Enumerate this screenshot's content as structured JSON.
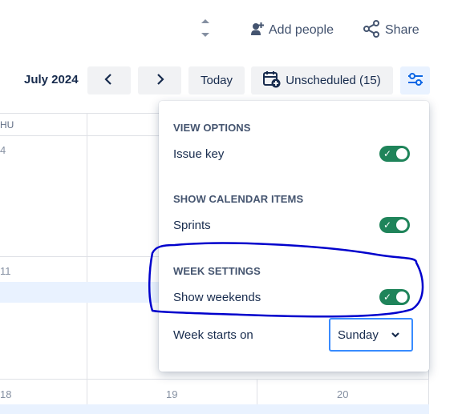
{
  "toolbar": {
    "add_people_label": "Add people",
    "share_label": "Share"
  },
  "nav": {
    "month": "July 2024",
    "today_label": "Today",
    "unscheduled_label": "Unscheduled (15)"
  },
  "calendar": {
    "day_header": "HU",
    "dates": [
      "4",
      "11",
      "18",
      "19",
      "20"
    ]
  },
  "view_options": {
    "section1_title": "VIEW OPTIONS",
    "issue_key_label": "Issue key",
    "section2_title": "SHOW CALENDAR ITEMS",
    "sprints_label": "Sprints",
    "section3_title": "WEEK SETTINGS",
    "show_weekends_label": "Show weekends",
    "week_starts_label": "Week starts on",
    "week_starts_value": "Sunday",
    "toggles": {
      "issue_key": true,
      "sprints": true,
      "show_weekends": true
    }
  },
  "colors": {
    "toggle_on": "#1f845a",
    "accent": "#388bff",
    "annotation": "#0000cc"
  },
  "icons": [
    "scroll-arrows-icon",
    "add-person-icon",
    "share-icon",
    "chevron-left-icon",
    "chevron-right-icon",
    "calendar-add-icon",
    "filter-sliders-icon",
    "check-icon",
    "chevron-down-icon"
  ]
}
